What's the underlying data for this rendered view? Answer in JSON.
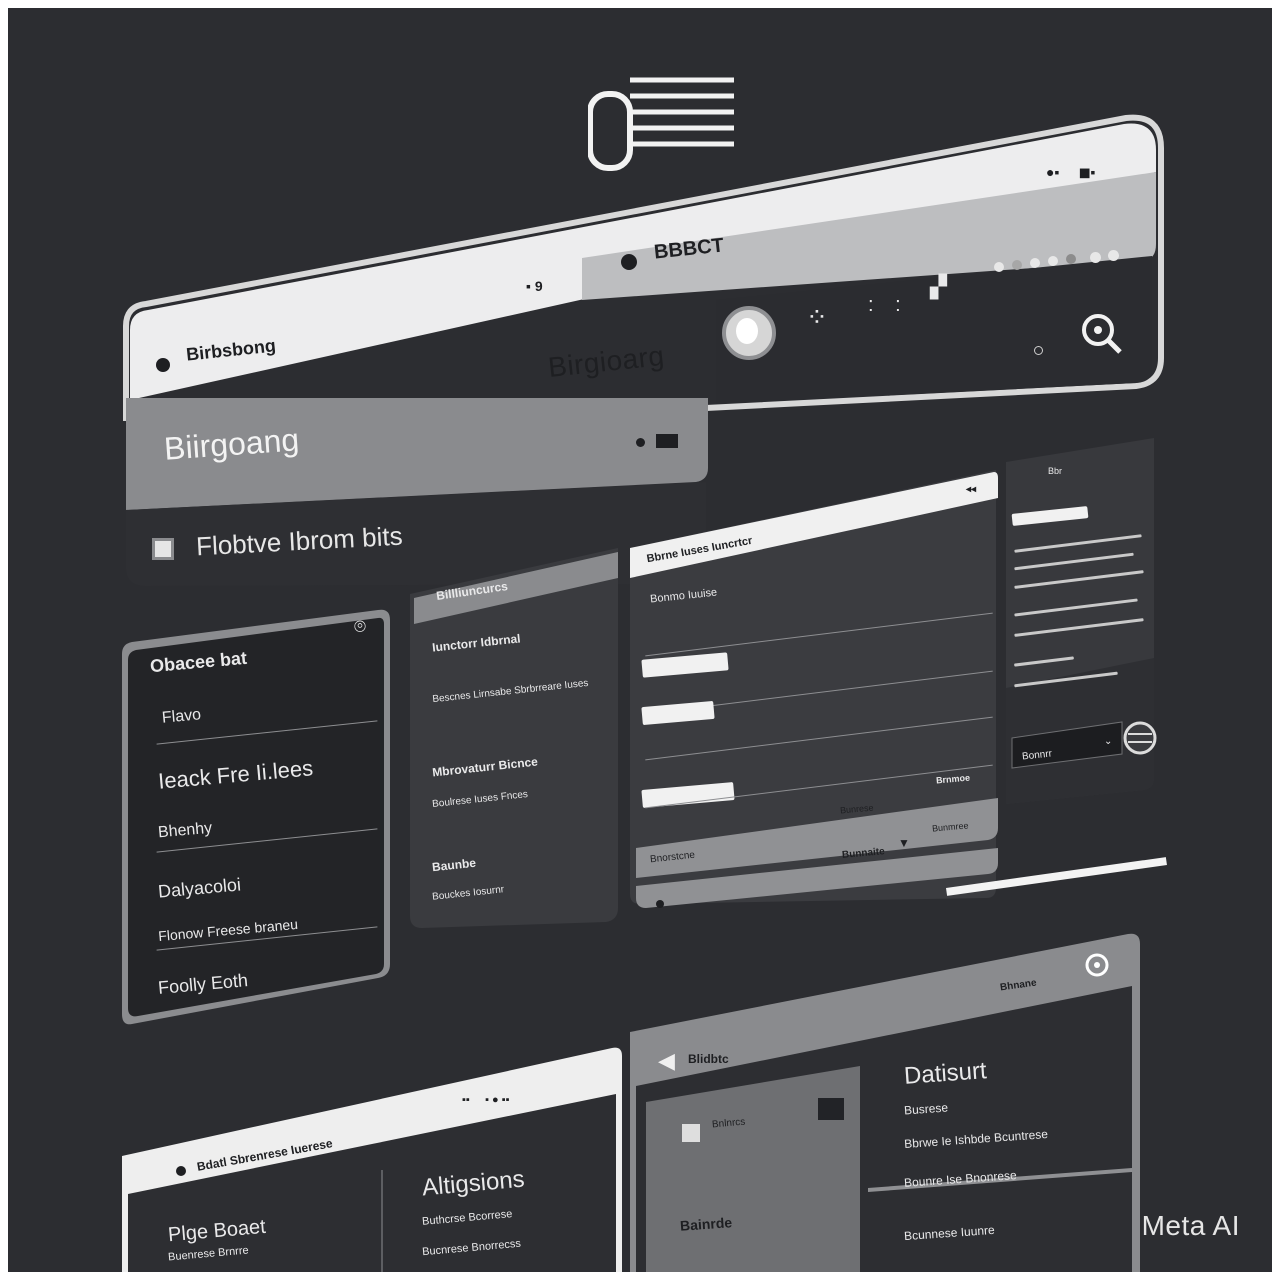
{
  "app": {
    "logo_icon": "logo-mark-icon",
    "watermark": "Meta AI"
  },
  "top_window": {
    "tab_left_label": "Birbsbong",
    "tab_right_label": "BBBCT",
    "header_title": "Birgioarg",
    "toolbar_icons": [
      "user-avatar-icon",
      "grid-icon",
      "dots-icon",
      "window-icon",
      "dots-row-icon",
      "search-icon"
    ]
  },
  "hero_panel": {
    "title": "Biirgoang",
    "subtitle": "Flobtve Ibrom bits"
  },
  "left_menu": {
    "title": "Obacee bat",
    "items": [
      "Flavo",
      "Ieack Fre Ii.lees",
      "Bhenhy",
      "Dalyacoloi",
      "Flonow Freese braneu",
      "Foolly Eoth"
    ]
  },
  "middle_card": {
    "header": "Billliuncurcs",
    "entries": [
      {
        "title": "Iunctorr Idbrnal",
        "detail": "Bescnes Lirnsabe Sbrbrreare Iuses"
      },
      {
        "title": "Mbrovaturr Bicnce",
        "detail": "Boulrese Iuses Fnces"
      },
      {
        "title": "Baunbe",
        "detail": "Bouckes Iosurnr"
      }
    ]
  },
  "form_card": {
    "header": "Bbrne Iuses Iuncrtcr",
    "label": "Bonmo Iuuise",
    "buttons": [
      "Brnmoe",
      "Bunrese",
      "Bunmree"
    ],
    "footer_note": "Bunnaite",
    "footer_link": "Bnorstcne"
  },
  "right_panel": {
    "header": "Bbr",
    "input_value": "Bonnrr"
  },
  "bottom_left_card": {
    "tab_label": "Bdatl Sbrenrese Iuerese",
    "section_title": "Altigsions",
    "section_lines": [
      "Buthcrse Bcorrese",
      "Bucnrese Bnorrecss"
    ],
    "card_title": "Plge Boaet",
    "card_subtitle": "Buenrese Brnrre"
  },
  "bottom_right_card": {
    "header": "Bhnane",
    "back_label": "Blidbtc",
    "item_label": "Bnlnrcs",
    "inner_title": "Bainrde",
    "title": "Datisurt",
    "subtitle": "Busrese",
    "lines": [
      "Bbrwe Ie Ishbde Bcuntrese",
      "Bounre Ise Bnonrese",
      "Bcunnese Iuunre"
    ]
  }
}
